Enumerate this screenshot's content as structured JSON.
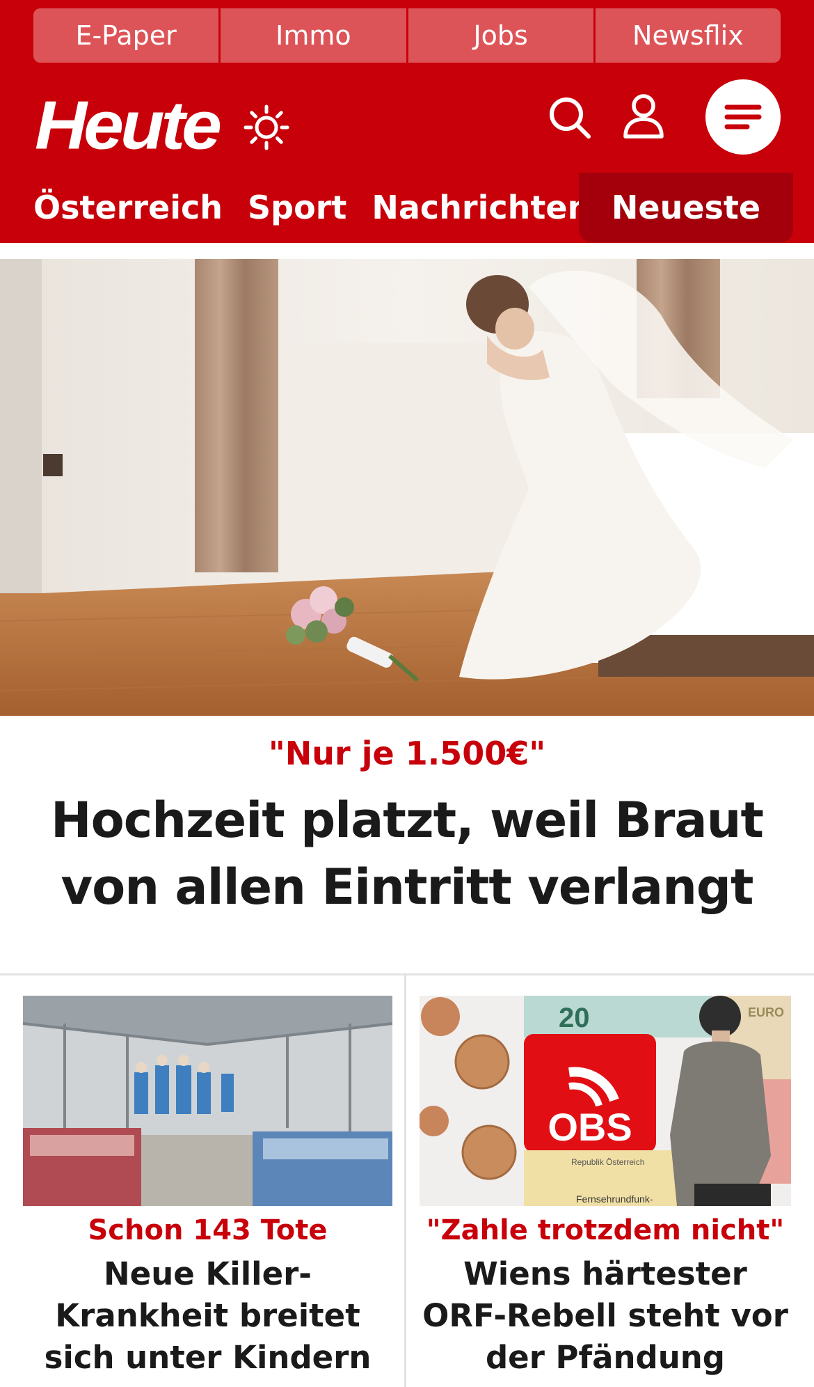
{
  "topnav": [
    "E-Paper",
    "Immo",
    "Jobs",
    "Newsflix"
  ],
  "brand": {
    "logo": "Heute"
  },
  "icons": {
    "theme": "sun-icon",
    "search": "search-icon",
    "account": "user-icon",
    "menu": "menu-icon"
  },
  "mainnav": {
    "items": [
      "Österreich",
      "Sport",
      "Nachrichten"
    ],
    "active": "Neueste"
  },
  "hero": {
    "kicker": "\"Nur je 1.500€\"",
    "title": "Hochzeit platzt, weil Braut von allen Eintritt verlangt"
  },
  "cards": [
    {
      "kicker": "Schon 143 Tote",
      "title": "Neue Killer-Krankheit breitet sich unter Kindern aus"
    },
    {
      "kicker": "\"Zahle trotzdem nicht\"",
      "title": "Wiens härtester ORF-Rebell steht vor der Pfändung"
    }
  ],
  "image_text": {
    "obs_logo": "OBS",
    "document": "Republik Österreich",
    "form": "Fernsehrundfunk-",
    "banknote": "20",
    "euro": "EURO"
  },
  "colors": {
    "brand_red": "#c8000a",
    "active_tab": "#a3000b",
    "topnav_bg": "#dd5458"
  }
}
